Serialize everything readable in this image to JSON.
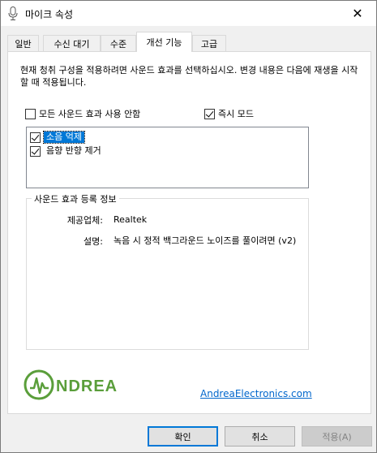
{
  "window": {
    "title": "마이크 속성",
    "close_glyph": "✕"
  },
  "tabs": [
    {
      "label": "일반"
    },
    {
      "label": "수신 대기"
    },
    {
      "label": "수준"
    },
    {
      "label": "개선 기능",
      "active": true
    },
    {
      "label": "고급"
    }
  ],
  "description": "현재 청취 구성을 적용하려면 사운드 효과를 선택하십시오. 변경 내용은 다음에 재생을 시작할 때 적용됩니다.",
  "options": {
    "disable_all": {
      "label": "모든 사운드 효과 사용 안함",
      "checked": false
    },
    "immediate_mode": {
      "label": "즉시 모드",
      "checked": true
    }
  },
  "effects": [
    {
      "label": "소음 억제",
      "checked": true,
      "selected": true
    },
    {
      "label": "음향 반향 제거",
      "checked": true,
      "selected": false
    }
  ],
  "effect_info": {
    "group_title": "사운드 효과 등록 정보",
    "provider_label": "제공업체:",
    "provider_value": "Realtek",
    "description_label": "설명:",
    "description_value": "녹음 시 정적 백그라운드 노이즈를 풀이려면 (v2)"
  },
  "branding": {
    "logo_text": "NDREA",
    "logo_letter": "A",
    "link_text": "AndreaElectronics.com",
    "logo_color": "#5a9e3a"
  },
  "buttons": {
    "ok": "확인",
    "cancel": "취소",
    "apply": "적용(A)"
  }
}
